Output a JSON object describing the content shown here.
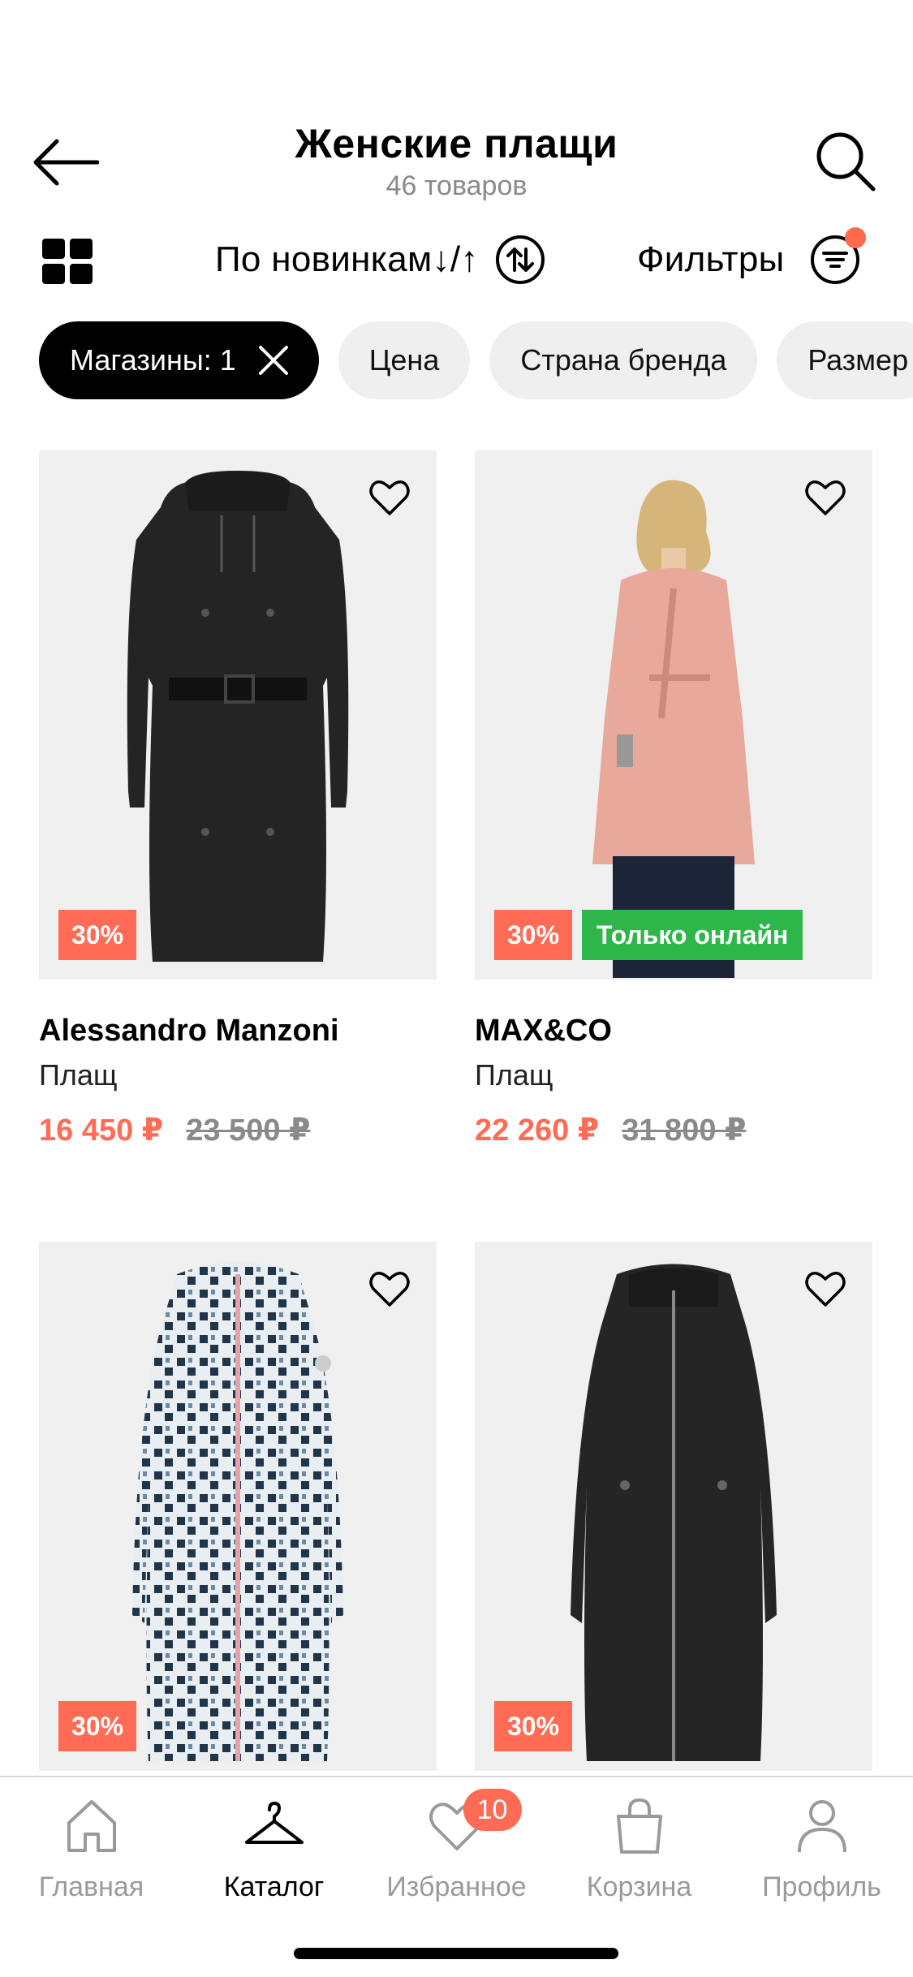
{
  "header": {
    "title": "Женские плащи",
    "subtitle": "46 товаров"
  },
  "toolbar": {
    "sort_label": "По новинкам↓/↑",
    "filter_label": "Фильтры"
  },
  "chips": [
    {
      "label": "Магазины: 1",
      "active": true
    },
    {
      "label": "Цена",
      "active": false
    },
    {
      "label": "Страна бренда",
      "active": false
    },
    {
      "label": "Размер",
      "active": false
    }
  ],
  "products": [
    {
      "brand": "Alessandro Manzoni",
      "type": "Плащ",
      "price_new": "16 450 ₽",
      "price_old": "23 500 ₽",
      "discount": "30%",
      "online_badge": ""
    },
    {
      "brand": "MAX&CO",
      "type": "Плащ",
      "price_new": "22 260 ₽",
      "price_old": "31 800 ₽",
      "discount": "30%",
      "online_badge": "Только онлайн"
    },
    {
      "brand": "",
      "type": "",
      "price_new": "",
      "price_old": "",
      "discount": "30%",
      "online_badge": ""
    },
    {
      "brand": "",
      "type": "",
      "price_new": "",
      "price_old": "",
      "discount": "30%",
      "online_badge": ""
    }
  ],
  "bottom_nav": {
    "items": [
      {
        "label": "Главная",
        "icon": "home-icon"
      },
      {
        "label": "Каталог",
        "icon": "hanger-icon"
      },
      {
        "label": "Избранное",
        "icon": "heart-icon"
      },
      {
        "label": "Корзина",
        "icon": "bag-icon"
      },
      {
        "label": "Профиль",
        "icon": "profile-icon"
      }
    ],
    "favorites_badge": "10",
    "active": "Каталог"
  },
  "colors": {
    "accent": "#ff6b55",
    "online_badge": "#2fb64a",
    "card_bg": "#f0f0f0"
  }
}
